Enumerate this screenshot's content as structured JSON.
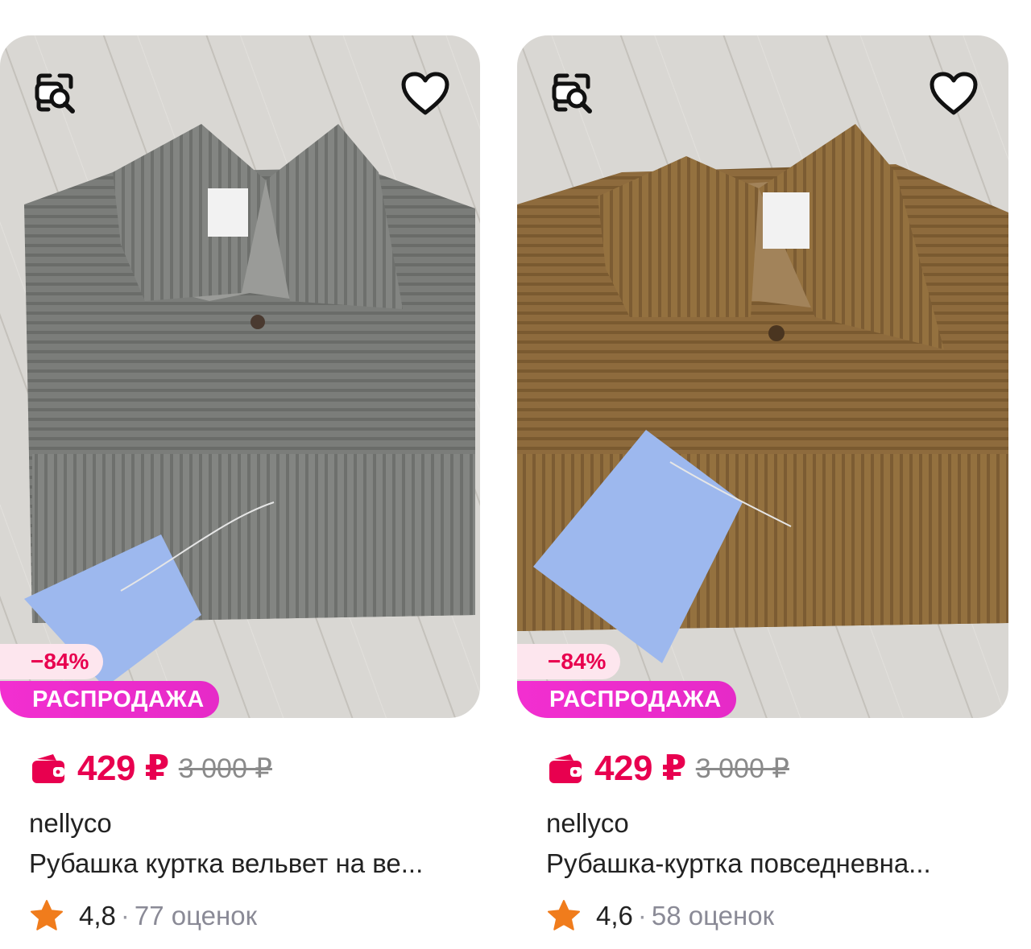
{
  "products": [
    {
      "discount": "−84%",
      "sale_label": "РАСПРОДАЖА",
      "price": "429 ₽",
      "old_price": "3 000 ₽",
      "brand": "nellyco",
      "title": "Рубашка куртка вельвет на ве...",
      "rating": "4,8",
      "separator": "·",
      "reviews": "77 оценок",
      "icons": {
        "search": "image-search-icon",
        "favorite": "heart-icon",
        "wallet": "wallet-icon",
        "star": "star-icon"
      },
      "shirt_color": "#7a7c79"
    },
    {
      "discount": "−84%",
      "sale_label": "РАСПРОДАЖА",
      "price": "429 ₽",
      "old_price": "3 000 ₽",
      "brand": "nellyco",
      "title": "Рубашка-куртка повседневна...",
      "rating": "4,6",
      "separator": "·",
      "reviews": "58 оценок",
      "icons": {
        "search": "image-search-icon",
        "favorite": "heart-icon",
        "wallet": "wallet-icon",
        "star": "star-icon"
      },
      "shirt_color": "#8d6a3c"
    }
  ],
  "colors": {
    "accent": "#e8004f",
    "sale": "#ee2bd4",
    "star": "#f07c1c",
    "tag": "#9db8ee"
  }
}
